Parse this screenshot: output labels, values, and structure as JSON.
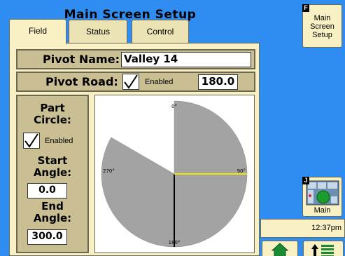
{
  "screen_title": "Main Screen Setup",
  "tabs": [
    {
      "label": "Field",
      "active": true
    },
    {
      "label": "Status",
      "active": false
    },
    {
      "label": "Control",
      "active": false
    }
  ],
  "pivot_name": {
    "label": "Pivot Name:",
    "value": "Valley 14"
  },
  "pivot_road": {
    "label": "Pivot Road:",
    "checked": true,
    "enabled_label": "Enabled",
    "value": "180.0"
  },
  "part_circle": {
    "title": "Part\nCircle:",
    "checked": true,
    "enabled_label": "Enabled",
    "start_angle_label": "Start\nAngle:",
    "start_angle_value": "0.0",
    "end_angle_label": "End\nAngle:",
    "end_angle_value": "300.0"
  },
  "diagram": {
    "start_angle": 0,
    "end_angle": 300,
    "pivot_road_angle": 180,
    "degree_labels": {
      "top": "0°",
      "right": "90°",
      "bottom": "180°",
      "left": "270°"
    },
    "colors": {
      "sector": "#a3a3a3",
      "heading": "#f2e500",
      "road": "#000000"
    }
  },
  "side": {
    "softkey_f": "F",
    "softkey_j": "J",
    "main_screen_setup_label": "Main\nScreen\nSetup",
    "main_label": "Main",
    "clock": "12:37pm"
  },
  "colors": {
    "background": "#2f8cf0",
    "panel": "#f9f1c4",
    "group": "#c9bf92"
  }
}
